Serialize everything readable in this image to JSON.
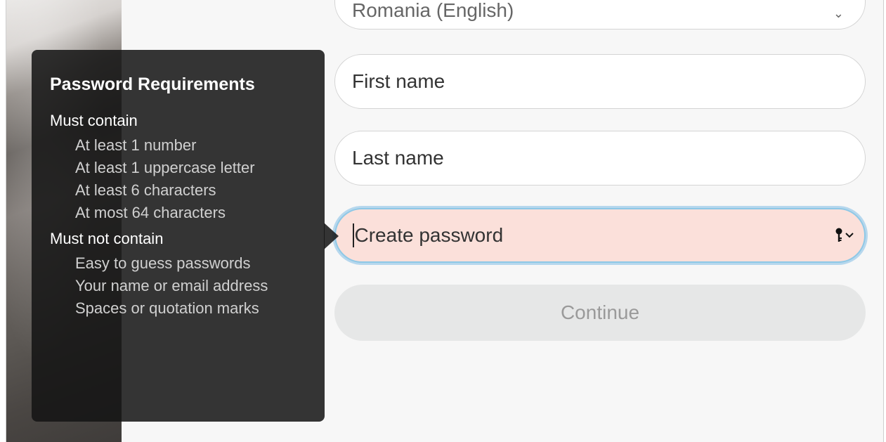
{
  "form": {
    "country_select": {
      "value": "Romania (English)"
    },
    "first_name": {
      "placeholder": "First name"
    },
    "last_name": {
      "placeholder": "Last name"
    },
    "password": {
      "placeholder": "Create password"
    },
    "continue_label": "Continue"
  },
  "tooltip": {
    "title": "Password Requirements",
    "must_contain_heading": "Must contain",
    "must_contain": [
      "At least 1 number",
      "At least 1 uppercase letter",
      "At least 6 characters",
      "At most 64 characters"
    ],
    "must_not_contain_heading": "Must not contain",
    "must_not_contain": [
      "Easy to guess passwords",
      "Your name or email address",
      "Spaces or quotation marks"
    ]
  },
  "colors": {
    "password_field_error": "#fbe0da",
    "focus_ring": "#8ec8e6",
    "continue_disabled": "#e6e7e7",
    "tooltip_bg": "#141414"
  },
  "icons": {
    "password_key": "key-icon",
    "password_dropdown": "chevron-down-icon"
  }
}
